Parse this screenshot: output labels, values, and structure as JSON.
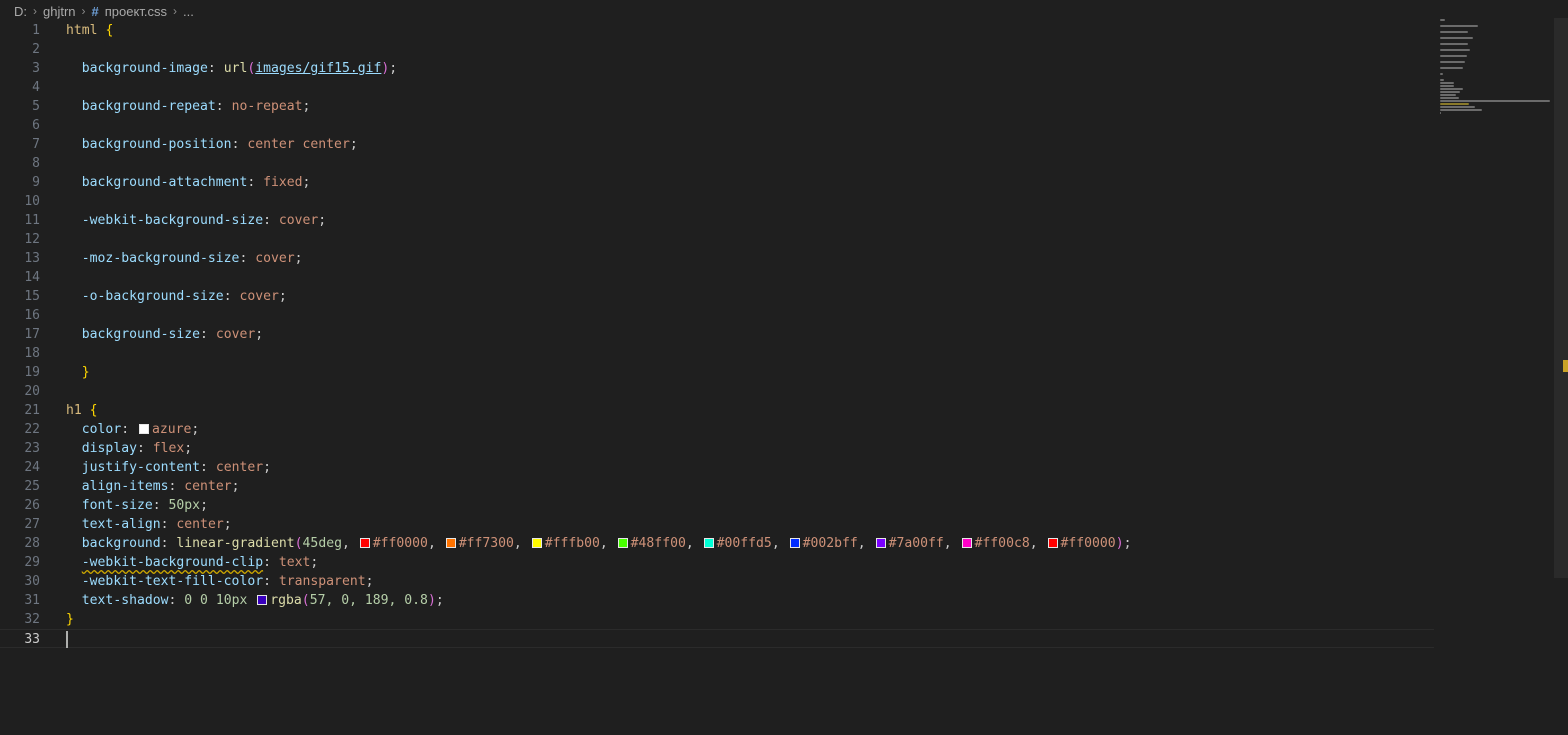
{
  "breadcrumb": {
    "drive": "D:",
    "folder": "ghjtrn",
    "file_icon": "#",
    "file": "проект.css",
    "more": "..."
  },
  "colors": {
    "background": "#1f1f1f",
    "line_numbers": "#6e7681",
    "selector": "#d7ba7d",
    "property": "#9cdcfe",
    "value": "#ce9178",
    "number": "#b5cea8",
    "function": "#dcdcaa",
    "brace": "#ffd700",
    "scroll_marker": "#c9a227"
  },
  "editor": {
    "active_line": 33,
    "line_count": 33,
    "lines": [
      {
        "n": "1",
        "tokens": [
          {
            "t": "html",
            "c": "sel"
          },
          {
            "t": " "
          },
          {
            "t": "{",
            "c": "brace"
          }
        ]
      },
      {
        "n": "2",
        "tokens": []
      },
      {
        "n": "3",
        "tokens": [
          {
            "t": "  "
          },
          {
            "t": "background-image",
            "c": "prop"
          },
          {
            "t": ": "
          },
          {
            "t": "url",
            "c": "fn"
          },
          {
            "t": "(",
            "c": "paren"
          },
          {
            "t": "images/gif15.gif",
            "c": "link"
          },
          {
            "t": ")",
            "c": "paren"
          },
          {
            "t": ";"
          }
        ]
      },
      {
        "n": "4",
        "tokens": []
      },
      {
        "n": "5",
        "tokens": [
          {
            "t": "  "
          },
          {
            "t": "background-repeat",
            "c": "prop"
          },
          {
            "t": ": "
          },
          {
            "t": "no-repeat",
            "c": "val"
          },
          {
            "t": ";"
          }
        ]
      },
      {
        "n": "6",
        "tokens": []
      },
      {
        "n": "7",
        "tokens": [
          {
            "t": "  "
          },
          {
            "t": "background-position",
            "c": "prop"
          },
          {
            "t": ": "
          },
          {
            "t": "center center",
            "c": "val"
          },
          {
            "t": ";"
          }
        ]
      },
      {
        "n": "8",
        "tokens": []
      },
      {
        "n": "9",
        "tokens": [
          {
            "t": "  "
          },
          {
            "t": "background-attachment",
            "c": "prop"
          },
          {
            "t": ": "
          },
          {
            "t": "fixed",
            "c": "val"
          },
          {
            "t": ";"
          }
        ]
      },
      {
        "n": "10",
        "tokens": []
      },
      {
        "n": "11",
        "tokens": [
          {
            "t": "  "
          },
          {
            "t": "-webkit-background-size",
            "c": "prop"
          },
          {
            "t": ": "
          },
          {
            "t": "cover",
            "c": "val"
          },
          {
            "t": ";"
          }
        ]
      },
      {
        "n": "12",
        "tokens": []
      },
      {
        "n": "13",
        "tokens": [
          {
            "t": "  "
          },
          {
            "t": "-moz-background-size",
            "c": "prop"
          },
          {
            "t": ": "
          },
          {
            "t": "cover",
            "c": "val"
          },
          {
            "t": ";"
          }
        ]
      },
      {
        "n": "14",
        "tokens": []
      },
      {
        "n": "15",
        "tokens": [
          {
            "t": "  "
          },
          {
            "t": "-o-background-size",
            "c": "prop"
          },
          {
            "t": ": "
          },
          {
            "t": "cover",
            "c": "val"
          },
          {
            "t": ";"
          }
        ]
      },
      {
        "n": "16",
        "tokens": []
      },
      {
        "n": "17",
        "tokens": [
          {
            "t": "  "
          },
          {
            "t": "background-size",
            "c": "prop"
          },
          {
            "t": ": "
          },
          {
            "t": "cover",
            "c": "val"
          },
          {
            "t": ";"
          }
        ]
      },
      {
        "n": "18",
        "tokens": []
      },
      {
        "n": "19",
        "tokens": [
          {
            "t": "  "
          },
          {
            "t": "}",
            "c": "brace"
          }
        ]
      },
      {
        "n": "20",
        "tokens": []
      },
      {
        "n": "21",
        "tokens": [
          {
            "t": "h1",
            "c": "sel"
          },
          {
            "t": " "
          },
          {
            "t": "{",
            "c": "brace"
          }
        ]
      },
      {
        "n": "22",
        "tokens": [
          {
            "t": "  "
          },
          {
            "t": "color",
            "c": "prop"
          },
          {
            "t": ": "
          },
          {
            "sw": "#ffffff"
          },
          {
            "t": "azure",
            "c": "val"
          },
          {
            "t": ";"
          }
        ]
      },
      {
        "n": "23",
        "tokens": [
          {
            "t": "  "
          },
          {
            "t": "display",
            "c": "prop"
          },
          {
            "t": ": "
          },
          {
            "t": "flex",
            "c": "val"
          },
          {
            "t": ";"
          }
        ]
      },
      {
        "n": "24",
        "tokens": [
          {
            "t": "  "
          },
          {
            "t": "justify-content",
            "c": "prop"
          },
          {
            "t": ": "
          },
          {
            "t": "center",
            "c": "val"
          },
          {
            "t": ";"
          }
        ]
      },
      {
        "n": "25",
        "tokens": [
          {
            "t": "  "
          },
          {
            "t": "align-items",
            "c": "prop"
          },
          {
            "t": ": "
          },
          {
            "t": "center",
            "c": "val"
          },
          {
            "t": ";"
          }
        ]
      },
      {
        "n": "26",
        "tokens": [
          {
            "t": "  "
          },
          {
            "t": "font-size",
            "c": "prop"
          },
          {
            "t": ": "
          },
          {
            "t": "50px",
            "c": "num"
          },
          {
            "t": ";"
          }
        ]
      },
      {
        "n": "27",
        "tokens": [
          {
            "t": "  "
          },
          {
            "t": "text-align",
            "c": "prop"
          },
          {
            "t": ": "
          },
          {
            "t": "center",
            "c": "val"
          },
          {
            "t": ";"
          }
        ]
      },
      {
        "n": "28",
        "tokens": [
          {
            "t": "  "
          },
          {
            "t": "background",
            "c": "prop"
          },
          {
            "t": ": "
          },
          {
            "t": "linear-gradient",
            "c": "fn"
          },
          {
            "t": "(",
            "c": "paren"
          },
          {
            "t": "45deg",
            "c": "num"
          },
          {
            "t": ", "
          },
          {
            "sw": "#ff0000"
          },
          {
            "t": "#ff0000",
            "c": "val"
          },
          {
            "t": ", "
          },
          {
            "sw": "#ff7300"
          },
          {
            "t": "#ff7300",
            "c": "val"
          },
          {
            "t": ", "
          },
          {
            "sw": "#fffb00"
          },
          {
            "t": "#fffb00",
            "c": "val"
          },
          {
            "t": ", "
          },
          {
            "sw": "#48ff00"
          },
          {
            "t": "#48ff00",
            "c": "val"
          },
          {
            "t": ", "
          },
          {
            "sw": "#00ffd5"
          },
          {
            "t": "#00ffd5",
            "c": "val"
          },
          {
            "t": ", "
          },
          {
            "sw": "#002bff"
          },
          {
            "t": "#002bff",
            "c": "val"
          },
          {
            "t": ", "
          },
          {
            "sw": "#7a00ff"
          },
          {
            "t": "#7a00ff",
            "c": "val"
          },
          {
            "t": ", "
          },
          {
            "sw": "#ff00c8"
          },
          {
            "t": "#ff00c8",
            "c": "val"
          },
          {
            "t": ", "
          },
          {
            "sw": "#ff0000"
          },
          {
            "t": "#ff0000",
            "c": "val"
          },
          {
            "t": ")",
            "c": "paren"
          },
          {
            "t": ";"
          }
        ]
      },
      {
        "n": "29",
        "tokens": [
          {
            "t": "  "
          },
          {
            "t": "-webkit-background-clip",
            "c": "prop squiggle"
          },
          {
            "t": ": "
          },
          {
            "t": "text",
            "c": "val"
          },
          {
            "t": ";"
          }
        ]
      },
      {
        "n": "30",
        "tokens": [
          {
            "t": "  "
          },
          {
            "t": "-webkit-text-fill-color",
            "c": "prop"
          },
          {
            "t": ": "
          },
          {
            "t": "transparent",
            "c": "val"
          },
          {
            "t": ";"
          }
        ]
      },
      {
        "n": "31",
        "tokens": [
          {
            "t": "  "
          },
          {
            "t": "text-shadow",
            "c": "prop"
          },
          {
            "t": ": "
          },
          {
            "t": "0 0 10px",
            "c": "num"
          },
          {
            "t": " "
          },
          {
            "sw": "#3900bd"
          },
          {
            "t": "rgba",
            "c": "fn"
          },
          {
            "t": "(",
            "c": "paren"
          },
          {
            "t": "57, 0, 189, 0.8",
            "c": "num"
          },
          {
            "t": ")",
            "c": "paren"
          },
          {
            "t": ";"
          }
        ]
      },
      {
        "n": "32",
        "tokens": [
          {
            "t": "}",
            "c": "brace"
          }
        ]
      },
      {
        "n": "33",
        "tokens": []
      }
    ]
  }
}
